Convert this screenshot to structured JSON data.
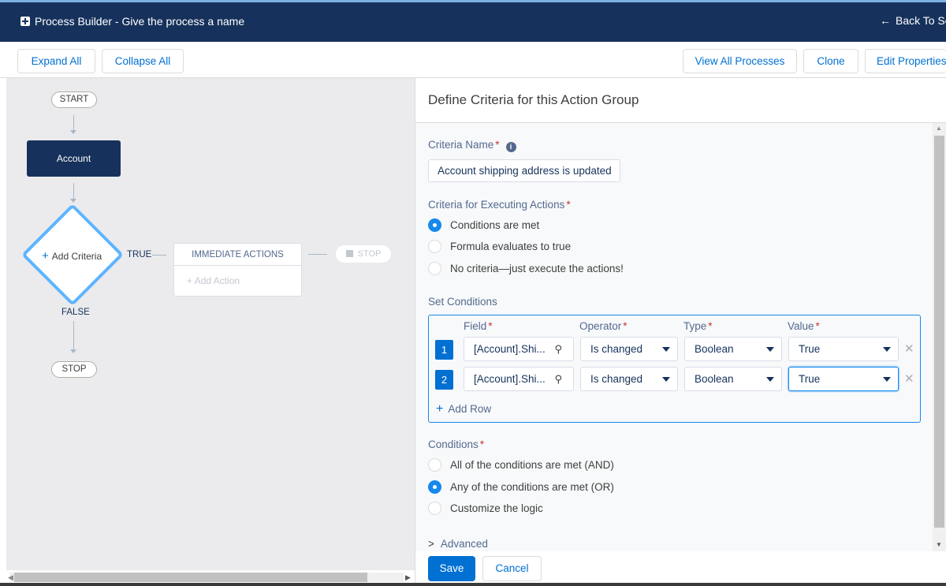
{
  "header": {
    "title": "Process Builder - Give the process a name",
    "back_arrow": "←",
    "back_label": "Back To Se"
  },
  "toolbar": {
    "expand_all": "Expand All",
    "collapse_all": "Collapse All",
    "view_all_processes": "View All Processes",
    "clone": "Clone",
    "edit_properties": "Edit Properties"
  },
  "canvas": {
    "start": "START",
    "object_node": "Account",
    "add_criteria": "Add Criteria",
    "true_label": "TRUE",
    "false_label": "FALSE",
    "immediate_actions": "IMMEDIATE ACTIONS",
    "add_action": "Add Action",
    "stop_right": "STOP",
    "stop_bottom": "STOP"
  },
  "panel": {
    "title": "Define Criteria for this Action Group",
    "criteria_name_label": "Criteria Name",
    "criteria_name_value": "Account shipping address is updated",
    "criteria_exec_label": "Criteria for Executing Actions",
    "exec_options": [
      {
        "label": "Conditions are met",
        "selected": true
      },
      {
        "label": "Formula evaluates to true",
        "selected": false
      },
      {
        "label": "No criteria—just execute the actions!",
        "selected": false
      }
    ],
    "set_conditions_label": "Set Conditions",
    "columns": {
      "field": "Field",
      "operator": "Operator",
      "type": "Type",
      "value": "Value"
    },
    "rows": [
      {
        "num": "1",
        "field": "[Account].Shi...",
        "operator": "Is changed",
        "type": "Boolean",
        "value": "True"
      },
      {
        "num": "2",
        "field": "[Account].Shi...",
        "operator": "Is changed",
        "type": "Boolean",
        "value": "True"
      }
    ],
    "add_row": "Add Row",
    "conditions_label": "Conditions",
    "condition_options": [
      {
        "label": "All of the conditions are met (AND)",
        "selected": false
      },
      {
        "label": "Any of the conditions are met (OR)",
        "selected": true
      },
      {
        "label": "Customize the logic",
        "selected": false
      }
    ],
    "advanced": "Advanced",
    "save": "Save",
    "cancel": "Cancel"
  },
  "colors": {
    "header_bg": "#16325c",
    "brand_blue": "#0070d2",
    "focus_blue": "#1589ee",
    "required_red": "#c23934"
  },
  "icons": [
    "process-builder-icon",
    "back-arrow-icon",
    "plus-icon",
    "info-icon",
    "search-icon",
    "chevron-down-icon",
    "close-icon",
    "chevron-right-icon",
    "stop-icon"
  ]
}
